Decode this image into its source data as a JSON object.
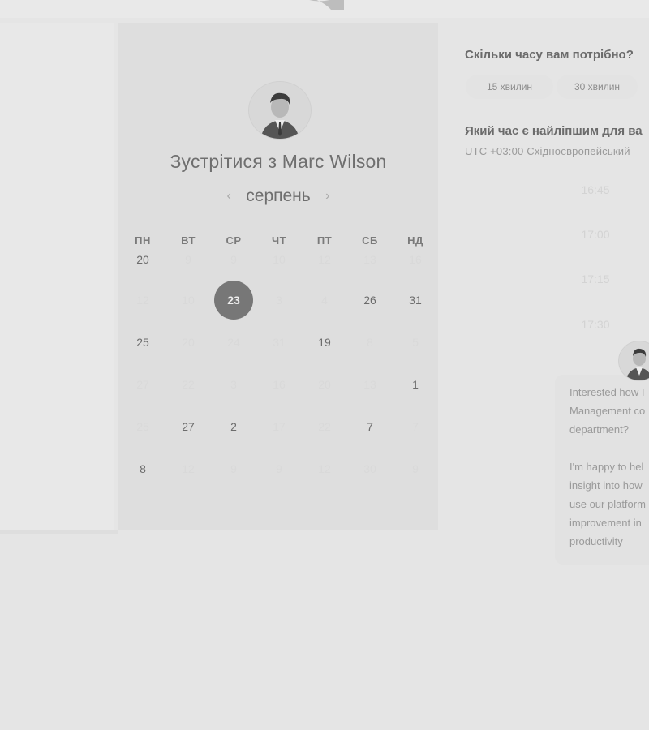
{
  "calendar": {
    "title": "Зустрітися з Marc Wilson",
    "month": "серпень",
    "prev_icon": "chevron-left-icon",
    "next_icon": "chevron-right-icon",
    "weekdays": [
      "ПН",
      "ВТ",
      "СР",
      "ЧТ",
      "ПТ",
      "СБ",
      "НД"
    ],
    "weeks": [
      [
        "20",
        "9",
        "9",
        "10",
        "12",
        "13",
        "16"
      ],
      [
        "12",
        "10",
        "23",
        "3",
        "4",
        "26",
        "31"
      ],
      [
        "25",
        "20",
        "24",
        "31",
        "19",
        "8",
        "5"
      ],
      [
        "27",
        "22",
        "3",
        "16",
        "20",
        "13",
        "1"
      ],
      [
        "25",
        "27",
        "2",
        "17",
        "22",
        "7",
        "7"
      ],
      [
        "8",
        "12",
        "9",
        "9",
        "12",
        "30",
        "9"
      ]
    ],
    "available": [
      [
        true,
        false,
        false,
        false,
        false,
        false,
        false
      ],
      [
        false,
        false,
        true,
        false,
        false,
        true,
        true
      ],
      [
        true,
        false,
        false,
        false,
        true,
        false,
        false
      ],
      [
        false,
        false,
        false,
        false,
        false,
        false,
        true
      ],
      [
        false,
        true,
        true,
        false,
        false,
        true,
        false
      ],
      [
        true,
        false,
        false,
        false,
        false,
        false,
        false
      ]
    ],
    "selected": {
      "week": 1,
      "day": 2
    }
  },
  "duration": {
    "question": "Скільки часу вам потрібно?",
    "options": [
      "15 хвилин",
      "30 хвилин"
    ]
  },
  "time": {
    "question": "Який час є найліпшим для ва",
    "timezone": "UTC +03:00 Східноєвропейський",
    "slots": [
      "16:45",
      "17:00",
      "17:15",
      "17:30"
    ]
  },
  "chat": {
    "lines_1": [
      "Interested how I",
      "Management co",
      "department?"
    ],
    "lines_2": [
      "I'm happy to hel",
      "insight into how",
      "use our platform",
      "improvement in",
      "productivity"
    ]
  },
  "colors": {
    "background": "#e5e5e5",
    "card": "#dedede",
    "selected_day": "#777777"
  }
}
